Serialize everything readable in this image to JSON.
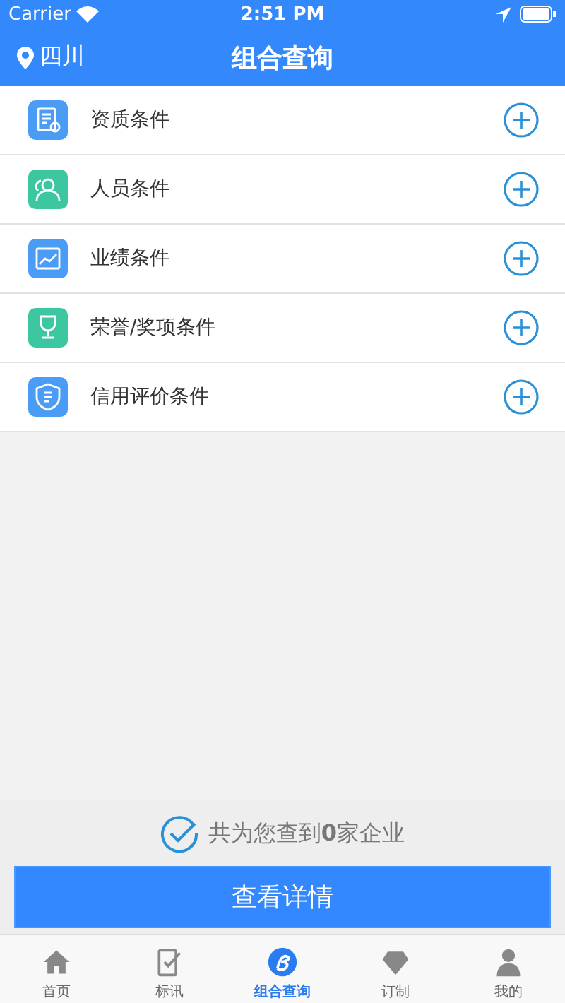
{
  "status_bar": {
    "carrier": "Carrier",
    "time": "2:51 PM"
  },
  "nav_bar": {
    "location": "四川",
    "title": "组合查询"
  },
  "conditions": [
    {
      "kind": "certificate",
      "label": "资质条件"
    },
    {
      "kind": "people",
      "label": "人员条件"
    },
    {
      "kind": "chart",
      "label": "业绩条件"
    },
    {
      "kind": "trophy",
      "label": "荣誉/奖项条件"
    },
    {
      "kind": "shield",
      "label": "信用评价条件"
    }
  ],
  "summary": "共为您查到**0**家企业",
  "detail_button": "查看详情",
  "tab_bar": [
    {
      "kind": "home",
      "label": "首页",
      "selected": false
    },
    {
      "kind": "bid",
      "label": "标讯",
      "selected": false
    },
    {
      "kind": "combo",
      "label": "组合查询",
      "selected": true
    },
    {
      "kind": "diamond",
      "label": "订制",
      "selected": false
    },
    {
      "kind": "person",
      "label": "我的",
      "selected": false
    }
  ]
}
